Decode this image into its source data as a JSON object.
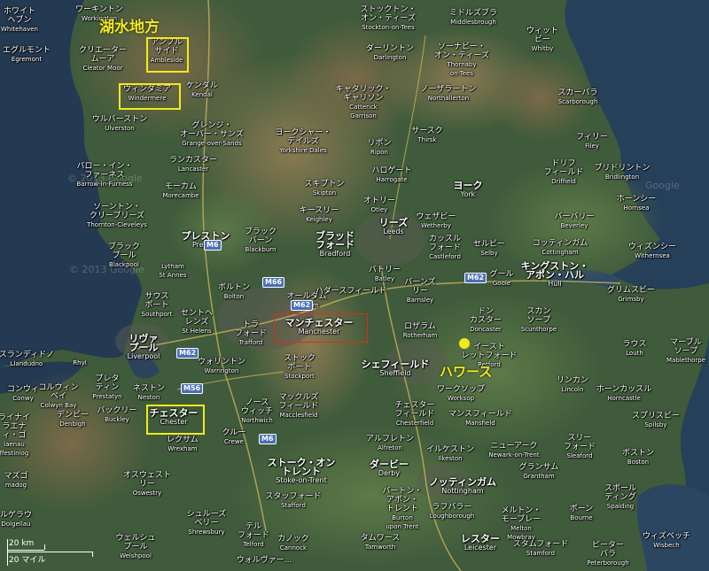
{
  "overlay": {
    "lake_district": "湖水地方",
    "haworth": "ハワース"
  },
  "watermarks": [
    "© 2013 Google",
    "© 2013 Google",
    "Google"
  ],
  "scale": {
    "km": "20 km",
    "mi": "20 マイル"
  },
  "roads": [
    "M6",
    "M66",
    "M62",
    "M62",
    "M62",
    "M56",
    "M6"
  ],
  "places": [
    {
      "id": "whitehaven",
      "jp": "ホワイト\nヘブン",
      "en": "Whitehaven"
    },
    {
      "id": "workington",
      "jp": "ワーキントン",
      "en": "Workington"
    },
    {
      "id": "egremont",
      "jp": "エグルモント",
      "en": "Egremont"
    },
    {
      "id": "cleator-moor",
      "jp": "クリエーター\nムーア",
      "en": "Cleator Moor"
    },
    {
      "id": "ambleside",
      "jp": "アンブル\nサイド",
      "en": "Ambleside"
    },
    {
      "id": "windermere",
      "jp": "ウィンダミア",
      "en": "Windermere"
    },
    {
      "id": "kendal",
      "jp": "ケンダル",
      "en": "Kendal"
    },
    {
      "id": "ulverston",
      "jp": "ウルバーストン",
      "en": "Ulverston"
    },
    {
      "id": "grange",
      "jp": "グレンジ・\nオーバー・サンズ",
      "en": "Grange-over-Sands"
    },
    {
      "id": "yorkshire-dales",
      "jp": "ヨークシャー・\nデイルズ",
      "en": "Yorkshire Dales"
    },
    {
      "id": "barrow",
      "jp": "バロー・イン・\nファーネス",
      "en": "Barrow-in-Furness"
    },
    {
      "id": "lancaster",
      "jp": "ランカスター",
      "en": "Lancaster"
    },
    {
      "id": "morecambe",
      "jp": "モーカム",
      "en": "Morecambe"
    },
    {
      "id": "thornton",
      "jp": "ソーントン・\nクリーブリーズ",
      "en": "Thornton-Cleveleys"
    },
    {
      "id": "blackpool",
      "jp": "ブラック\nプール",
      "en": "Blackpool"
    },
    {
      "id": "lytham",
      "jp": "",
      "en": "Lytham\nSt Annes"
    },
    {
      "id": "southport",
      "jp": "サウス\nポート",
      "en": "Southport"
    },
    {
      "id": "preston",
      "jp": "プレストン",
      "en": "Preston"
    },
    {
      "id": "blackburn",
      "jp": "ブラック\nバーン",
      "en": "Blackburn"
    },
    {
      "id": "bolton",
      "jp": "ボルトン",
      "en": "Bolton"
    },
    {
      "id": "oldham",
      "jp": "オールダム",
      "en": "Oldham"
    },
    {
      "id": "st-helens",
      "jp": "セントヘ\nレンズ",
      "en": "St Helens"
    },
    {
      "id": "trafford",
      "jp": "トラ\nフォード",
      "en": "Trafford"
    },
    {
      "id": "manchester",
      "jp": "マンチェスター",
      "en": "Manchester"
    },
    {
      "id": "liverpool",
      "jp": "リヴァ\nプール",
      "en": "Liverpool"
    },
    {
      "id": "warrington",
      "jp": "ウォリントン",
      "en": "Warrington"
    },
    {
      "id": "stockport",
      "jp": "ストック\nポート",
      "en": "Stockport"
    },
    {
      "id": "llandudno",
      "jp": "スランディドノ",
      "en": "Llandudno"
    },
    {
      "id": "rhyl",
      "jp": "",
      "en": "Rhyl"
    },
    {
      "id": "conwy",
      "jp": "コンウィ",
      "en": "Conwy"
    },
    {
      "id": "colwyn-bay",
      "jp": "コルウィン\nベイ",
      "en": "Colwyn Bay"
    },
    {
      "id": "prestatyn",
      "jp": "プレタ\nティン",
      "en": "Prestatyn"
    },
    {
      "id": "neston",
      "jp": "ネストン",
      "en": "Neston"
    },
    {
      "id": "denbigh",
      "jp": "デンビー",
      "en": "Denbigh"
    },
    {
      "id": "buckley",
      "jp": "バックリー",
      "en": "Buckley"
    },
    {
      "id": "chester",
      "jp": "チェスター",
      "en": "Chester"
    },
    {
      "id": "northwich",
      "jp": "ノース\nウィッチ",
      "en": "Northwich"
    },
    {
      "id": "macclesfield",
      "jp": "マックルズ\nフィールド",
      "en": "Macclesfield"
    },
    {
      "id": "crewe",
      "jp": "クルー",
      "en": "Crewe"
    },
    {
      "id": "wrexham",
      "jp": "レクサム",
      "en": "Wrexham"
    },
    {
      "id": "oswestry",
      "jp": "オスウェスト\nリー",
      "en": "Oswestry"
    },
    {
      "id": "shrewsbury",
      "jp": "シュルーズ\nベリー",
      "en": "Shrewsbury"
    },
    {
      "id": "welshpool",
      "jp": "ウェルシュ\nプール",
      "en": "Welshpool"
    },
    {
      "id": "telford",
      "jp": "テル\nフォード",
      "en": "Telford"
    },
    {
      "id": "stoke",
      "jp": "ストーク・オン\nトレント",
      "en": "Stoke-on-Trent"
    },
    {
      "id": "stafford",
      "jp": "スタッフォード",
      "en": "Stafford"
    },
    {
      "id": "cannock",
      "jp": "カノック",
      "en": "Cannock"
    },
    {
      "id": "wolverhampton",
      "jp": "ウォルヴァー...",
      "en": ""
    },
    {
      "id": "stockton",
      "jp": "ストックトン・\nオン・ティーズ",
      "en": "Stockton-on-Tees"
    },
    {
      "id": "middlesbrough",
      "jp": "ミドルズブラ",
      "en": "Middlesbrough"
    },
    {
      "id": "darlington",
      "jp": "ダーリントン",
      "en": "Darlington"
    },
    {
      "id": "thornaby",
      "jp": "ソーナビー・\nオン・ティーズ",
      "en": "Thornaby\non-Tees"
    },
    {
      "id": "whitby",
      "jp": "ウィット\nビー",
      "en": "Whitby"
    },
    {
      "id": "catterick",
      "jp": "キャタリック・\nギャリソン",
      "en": "Catterick\nGarrison"
    },
    {
      "id": "northallerton",
      "jp": "ノーザラートン",
      "en": "Northallerton"
    },
    {
      "id": "scarborough",
      "jp": "スカーバラ",
      "en": "Scarborough"
    },
    {
      "id": "thirsk",
      "jp": "サースク",
      "en": "Thirsk"
    },
    {
      "id": "ripon",
      "jp": "リポン",
      "en": "Ripon"
    },
    {
      "id": "filey",
      "jp": "フィリー",
      "en": "Filey"
    },
    {
      "id": "driffield",
      "jp": "ドリフ\nフィールド",
      "en": "Driffield"
    },
    {
      "id": "bridlington",
      "jp": "ブリドリントン",
      "en": "Bridlington"
    },
    {
      "id": "harrogate",
      "jp": "ハロゲート",
      "en": "Harrogate"
    },
    {
      "id": "skipton",
      "jp": "スキプトン",
      "en": "Skipton"
    },
    {
      "id": "york",
      "jp": "ヨーク",
      "en": "York"
    },
    {
      "id": "keighley",
      "jp": "キースリー",
      "en": "Keighley"
    },
    {
      "id": "otley",
      "jp": "オトリー",
      "en": "Otley"
    },
    {
      "id": "hornsea",
      "jp": "ホーンシー",
      "en": "Hornsea"
    },
    {
      "id": "wetherby",
      "jp": "ウェザビー",
      "en": "Wetherby"
    },
    {
      "id": "beverley",
      "jp": "バーバリー",
      "en": "Beverley"
    },
    {
      "id": "bradford",
      "jp": "ブラッド\nフォード",
      "en": "Bradford"
    },
    {
      "id": "leeds",
      "jp": "リーズ",
      "en": "Leeds"
    },
    {
      "id": "castleford",
      "jp": "カッスル\nフォード",
      "en": "Castleford"
    },
    {
      "id": "selby",
      "jp": "セルビー",
      "en": "Selby"
    },
    {
      "id": "cottingham",
      "jp": "コッティンガム",
      "en": "Cottingham"
    },
    {
      "id": "withernsea",
      "jp": "ウィズンシー",
      "en": "Withernsea"
    },
    {
      "id": "batley",
      "jp": "バトリー",
      "en": "Batley"
    },
    {
      "id": "goole",
      "jp": "グール",
      "en": "Goole"
    },
    {
      "id": "hull",
      "jp": "キングストン・\nアポン・ハル",
      "en": "Hull"
    },
    {
      "id": "huddersfield",
      "jp": "ハダースフィールド",
      "en": ""
    },
    {
      "id": "barnsley",
      "jp": "バーンズ\nリー",
      "en": "Barnsley"
    },
    {
      "id": "grimsby",
      "jp": "グリムスビー",
      "en": "Grimsby"
    },
    {
      "id": "doncaster",
      "jp": "ドン\nカスター",
      "en": "Doncaster"
    },
    {
      "id": "scunthorpe",
      "jp": "スカン\nソープ",
      "en": "Scunthorpe"
    },
    {
      "id": "rotherham",
      "jp": "ロザラム",
      "en": "Rotherham"
    },
    {
      "id": "east-retford",
      "jp": "イースト\nレットフォード",
      "en": "Retford"
    },
    {
      "id": "louth",
      "jp": "ラウス",
      "en": "Louth"
    },
    {
      "id": "mablethorpe",
      "jp": "マーブル\nソープ",
      "en": "Mablethorpe"
    },
    {
      "id": "sheffield",
      "jp": "シェフィールド",
      "en": "Sheffield"
    },
    {
      "id": "worksop",
      "jp": "ワークソップ",
      "en": "Worksop"
    },
    {
      "id": "lincoln",
      "jp": "リンカン",
      "en": "Lincoln"
    },
    {
      "id": "horncastle",
      "jp": "ホーンカッスル",
      "en": "Horncastle"
    },
    {
      "id": "chesterfield",
      "jp": "チェスター\nフィールド",
      "en": "Chesterfield"
    },
    {
      "id": "mansfield",
      "jp": "マンスフィールド",
      "en": "Mansfield"
    },
    {
      "id": "spilsby",
      "jp": "スプリスビー",
      "en": "Spilsby"
    },
    {
      "id": "newark",
      "jp": "ニューアーク",
      "en": "Newark-on-Trent"
    },
    {
      "id": "alfreton",
      "jp": "アルフレトン",
      "en": "Alfreton"
    },
    {
      "id": "ilkeston",
      "jp": "イルケストン",
      "en": "Ilkeston"
    },
    {
      "id": "sleaford",
      "jp": "スリー\nフォード",
      "en": "Sleaford"
    },
    {
      "id": "derby",
      "jp": "ダービー",
      "en": "Derby"
    },
    {
      "id": "nottingham",
      "jp": "ノッティンガム",
      "en": "Nottingham"
    },
    {
      "id": "grantham",
      "jp": "グランサム",
      "en": "Grantham"
    },
    {
      "id": "boston",
      "jp": "ボストン",
      "en": "Boston"
    },
    {
      "id": "burton",
      "jp": "バートン・\nアポン・\nトレント",
      "en": "Burton\nupon Trent"
    },
    {
      "id": "loughborough",
      "jp": "ラフバラー",
      "en": "Loughborough"
    },
    {
      "id": "melton",
      "jp": "メルトン・\nモーブレー",
      "en": "Melton\nMowbray"
    },
    {
      "id": "bourne",
      "jp": "ボーン",
      "en": "Bourne"
    },
    {
      "id": "spalding",
      "jp": "スポール\nディング",
      "en": "Spalding"
    },
    {
      "id": "tamworth",
      "jp": "タムワース",
      "en": "Tamworth"
    },
    {
      "id": "leicester",
      "jp": "レスター",
      "en": "Leicester"
    },
    {
      "id": "stamford",
      "jp": "スタムフォード",
      "en": "Stamford"
    },
    {
      "id": "peterborough",
      "jp": "ピーター\nバラ",
      "en": "Peterborough"
    },
    {
      "id": "wisbech",
      "jp": "ウィズベッチ",
      "en": "Wisbech"
    },
    {
      "id": "anglesey-1",
      "jp": "ライナイ\nラエナ\nィ・ゴ",
      "en": "laenau\nffestiniog"
    },
    {
      "id": "anglesey-2",
      "jp": "マズゴ",
      "en": "madog"
    },
    {
      "id": "bala",
      "jp": "ルゲラウ",
      "en": "Dolgellau"
    }
  ]
}
